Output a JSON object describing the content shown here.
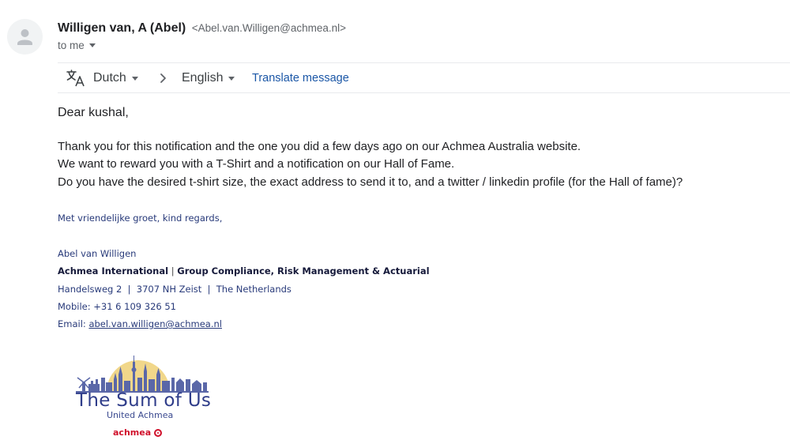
{
  "header": {
    "sender_name": "Willigen van, A (Abel)",
    "sender_email": "<Abel.van.Willigen@achmea.nl>",
    "recipient_label": "to me",
    "avatar_icon": "person-icon"
  },
  "translate_bar": {
    "icon": "translate-icon",
    "source_language": "Dutch",
    "target_language": "English",
    "translate_link": "Translate message"
  },
  "message": {
    "greeting": "Dear kushal,",
    "lines": [
      "Thank you for this notification and the one you did a few days ago on our Achmea Australia website.",
      "We want to reward you with a T-Shirt and a notification on our Hall of Fame.",
      "Do you have the desired t-shirt size, the exact address to send it to, and a twitter / linkedin profile (for the Hall of fame)?"
    ]
  },
  "signature": {
    "regards": "Met vriendelijke groet, kind regards,",
    "name": "Abel van Willigen",
    "company": "Achmea International",
    "company_sep": " | ",
    "department": "Group Compliance, Risk Management & Actuarial",
    "address": "Handelsweg 2  |  3707 NH Zeist  |  The Netherlands",
    "mobile": "Mobile: +31 6 109 326 51",
    "email_label": "Email: ",
    "email_link": "abel.van.willigen@achmea.nl"
  },
  "logo": {
    "title": "The Sum of Us",
    "subtitle": "United Achmea",
    "brand": "achmea",
    "colors": {
      "sun": "#f1d78a",
      "skyline": "#5a67a8",
      "title": "#2f3d8a",
      "brand": "#d0112b"
    }
  },
  "colors": {
    "link": "#1a56a6",
    "signature_text": "#283a7a",
    "divider": "#e8eaed"
  }
}
